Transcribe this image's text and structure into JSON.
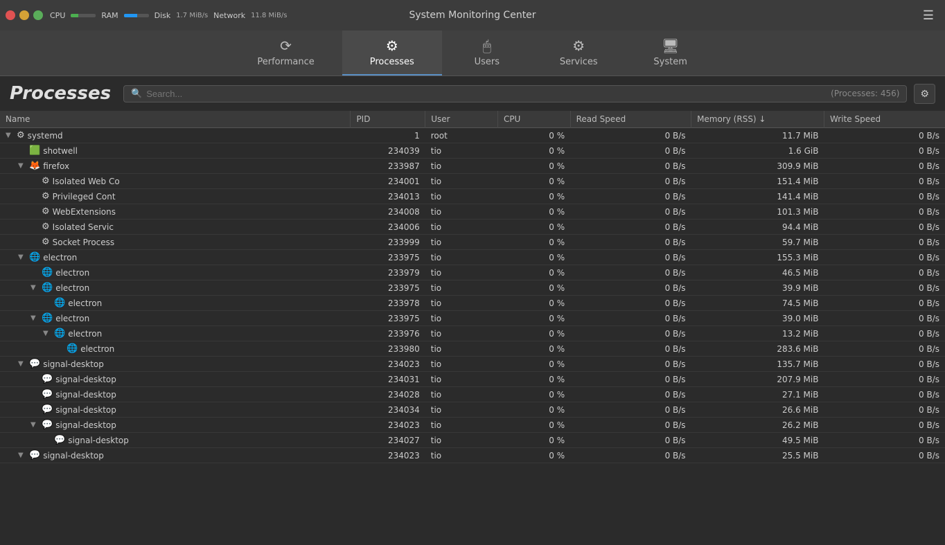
{
  "titlebar": {
    "title": "System Monitoring Center",
    "cpu_label": "CPU",
    "ram_label": "RAM",
    "disk_label": "Disk",
    "network_label": "Network",
    "disk_speed": "1.7 MiB/s",
    "network_speed": "11.8 MiB/s",
    "cpu_fill": 30,
    "ram_fill": 55
  },
  "nav": {
    "tabs": [
      {
        "id": "performance",
        "label": "Performance",
        "icon": "⟳"
      },
      {
        "id": "processes",
        "label": "Processes",
        "icon": "⚙"
      },
      {
        "id": "users",
        "label": "Users",
        "icon": "🖱"
      },
      {
        "id": "services",
        "label": "Services",
        "icon": "⚙"
      },
      {
        "id": "system",
        "label": "System",
        "icon": "🖥"
      }
    ],
    "active": "processes"
  },
  "page": {
    "title": "Processes",
    "search_placeholder": "Search...",
    "process_count": "(Processes: 456)"
  },
  "table": {
    "columns": [
      "Name",
      "PID",
      "User",
      "CPU",
      "Read Speed",
      "Memory (RSS) ↓",
      "Write Speed"
    ],
    "rows": [
      {
        "indent": 0,
        "arrow": "▼",
        "icon": "⚙",
        "name": "systemd",
        "pid": "1",
        "user": "root",
        "cpu": "0 %",
        "read": "0 B/s",
        "mem": "11.7 MiB",
        "write": "0 B/s"
      },
      {
        "indent": 1,
        "arrow": " ",
        "icon": "🟩",
        "name": "shotwell",
        "pid": "234039",
        "user": "tio",
        "cpu": "0 %",
        "read": "0 B/s",
        "mem": "1.6 GiB",
        "write": "0 B/s"
      },
      {
        "indent": 1,
        "arrow": "▼",
        "icon": "🦊",
        "name": "firefox",
        "pid": "233987",
        "user": "tio",
        "cpu": "0 %",
        "read": "0 B/s",
        "mem": "309.9 MiB",
        "write": "0 B/s"
      },
      {
        "indent": 2,
        "arrow": " ",
        "icon": "⚙",
        "name": "Isolated Web Co",
        "pid": "234001",
        "user": "tio",
        "cpu": "0 %",
        "read": "0 B/s",
        "mem": "151.4 MiB",
        "write": "0 B/s"
      },
      {
        "indent": 2,
        "arrow": " ",
        "icon": "⚙",
        "name": "Privileged Cont",
        "pid": "234013",
        "user": "tio",
        "cpu": "0 %",
        "read": "0 B/s",
        "mem": "141.4 MiB",
        "write": "0 B/s"
      },
      {
        "indent": 2,
        "arrow": " ",
        "icon": "⚙",
        "name": "WebExtensions",
        "pid": "234008",
        "user": "tio",
        "cpu": "0 %",
        "read": "0 B/s",
        "mem": "101.3 MiB",
        "write": "0 B/s"
      },
      {
        "indent": 2,
        "arrow": " ",
        "icon": "⚙",
        "name": "Isolated Servic",
        "pid": "234006",
        "user": "tio",
        "cpu": "0 %",
        "read": "0 B/s",
        "mem": "94.4 MiB",
        "write": "0 B/s"
      },
      {
        "indent": 2,
        "arrow": " ",
        "icon": "⚙",
        "name": "Socket Process",
        "pid": "233999",
        "user": "tio",
        "cpu": "0 %",
        "read": "0 B/s",
        "mem": "59.7 MiB",
        "write": "0 B/s"
      },
      {
        "indent": 1,
        "arrow": "▼",
        "icon": "🌐",
        "name": "electron",
        "pid": "233975",
        "user": "tio",
        "cpu": "0 %",
        "read": "0 B/s",
        "mem": "155.3 MiB",
        "write": "0 B/s"
      },
      {
        "indent": 2,
        "arrow": " ",
        "icon": "🌐",
        "name": "electron",
        "pid": "233979",
        "user": "tio",
        "cpu": "0 %",
        "read": "0 B/s",
        "mem": "46.5 MiB",
        "write": "0 B/s"
      },
      {
        "indent": 2,
        "arrow": "▼",
        "icon": "🌐",
        "name": "electron",
        "pid": "233975",
        "user": "tio",
        "cpu": "0 %",
        "read": "0 B/s",
        "mem": "39.9 MiB",
        "write": "0 B/s"
      },
      {
        "indent": 3,
        "arrow": " ",
        "icon": "🌐",
        "name": "electron",
        "pid": "233978",
        "user": "tio",
        "cpu": "0 %",
        "read": "0 B/s",
        "mem": "74.5 MiB",
        "write": "0 B/s"
      },
      {
        "indent": 2,
        "arrow": "▼",
        "icon": "🌐",
        "name": "electron",
        "pid": "233975",
        "user": "tio",
        "cpu": "0 %",
        "read": "0 B/s",
        "mem": "39.0 MiB",
        "write": "0 B/s"
      },
      {
        "indent": 3,
        "arrow": "▼",
        "icon": "🌐",
        "name": "electron",
        "pid": "233976",
        "user": "tio",
        "cpu": "0 %",
        "read": "0 B/s",
        "mem": "13.2 MiB",
        "write": "0 B/s"
      },
      {
        "indent": 4,
        "arrow": " ",
        "icon": "🌐",
        "name": "electron",
        "pid": "233980",
        "user": "tio",
        "cpu": "0 %",
        "read": "0 B/s",
        "mem": "283.6 MiB",
        "write": "0 B/s"
      },
      {
        "indent": 1,
        "arrow": "▼",
        "icon": "💬",
        "name": "signal-desktop",
        "pid": "234023",
        "user": "tio",
        "cpu": "0 %",
        "read": "0 B/s",
        "mem": "135.7 MiB",
        "write": "0 B/s"
      },
      {
        "indent": 2,
        "arrow": " ",
        "icon": "💬",
        "name": "signal-desktop",
        "pid": "234031",
        "user": "tio",
        "cpu": "0 %",
        "read": "0 B/s",
        "mem": "207.9 MiB",
        "write": "0 B/s"
      },
      {
        "indent": 2,
        "arrow": " ",
        "icon": "💬",
        "name": "signal-desktop",
        "pid": "234028",
        "user": "tio",
        "cpu": "0 %",
        "read": "0 B/s",
        "mem": "27.1 MiB",
        "write": "0 B/s"
      },
      {
        "indent": 2,
        "arrow": " ",
        "icon": "💬",
        "name": "signal-desktop",
        "pid": "234034",
        "user": "tio",
        "cpu": "0 %",
        "read": "0 B/s",
        "mem": "26.6 MiB",
        "write": "0 B/s"
      },
      {
        "indent": 2,
        "arrow": "▼",
        "icon": "💬",
        "name": "signal-desktop",
        "pid": "234023",
        "user": "tio",
        "cpu": "0 %",
        "read": "0 B/s",
        "mem": "26.2 MiB",
        "write": "0 B/s"
      },
      {
        "indent": 3,
        "arrow": " ",
        "icon": "💬",
        "name": "signal-desktop",
        "pid": "234027",
        "user": "tio",
        "cpu": "0 %",
        "read": "0 B/s",
        "mem": "49.5 MiB",
        "write": "0 B/s"
      },
      {
        "indent": 1,
        "arrow": "▼",
        "icon": "💬",
        "name": "signal-desktop",
        "pid": "234023",
        "user": "tio",
        "cpu": "0 %",
        "read": "0 B/s",
        "mem": "25.5 MiB",
        "write": "0 B/s"
      }
    ]
  }
}
